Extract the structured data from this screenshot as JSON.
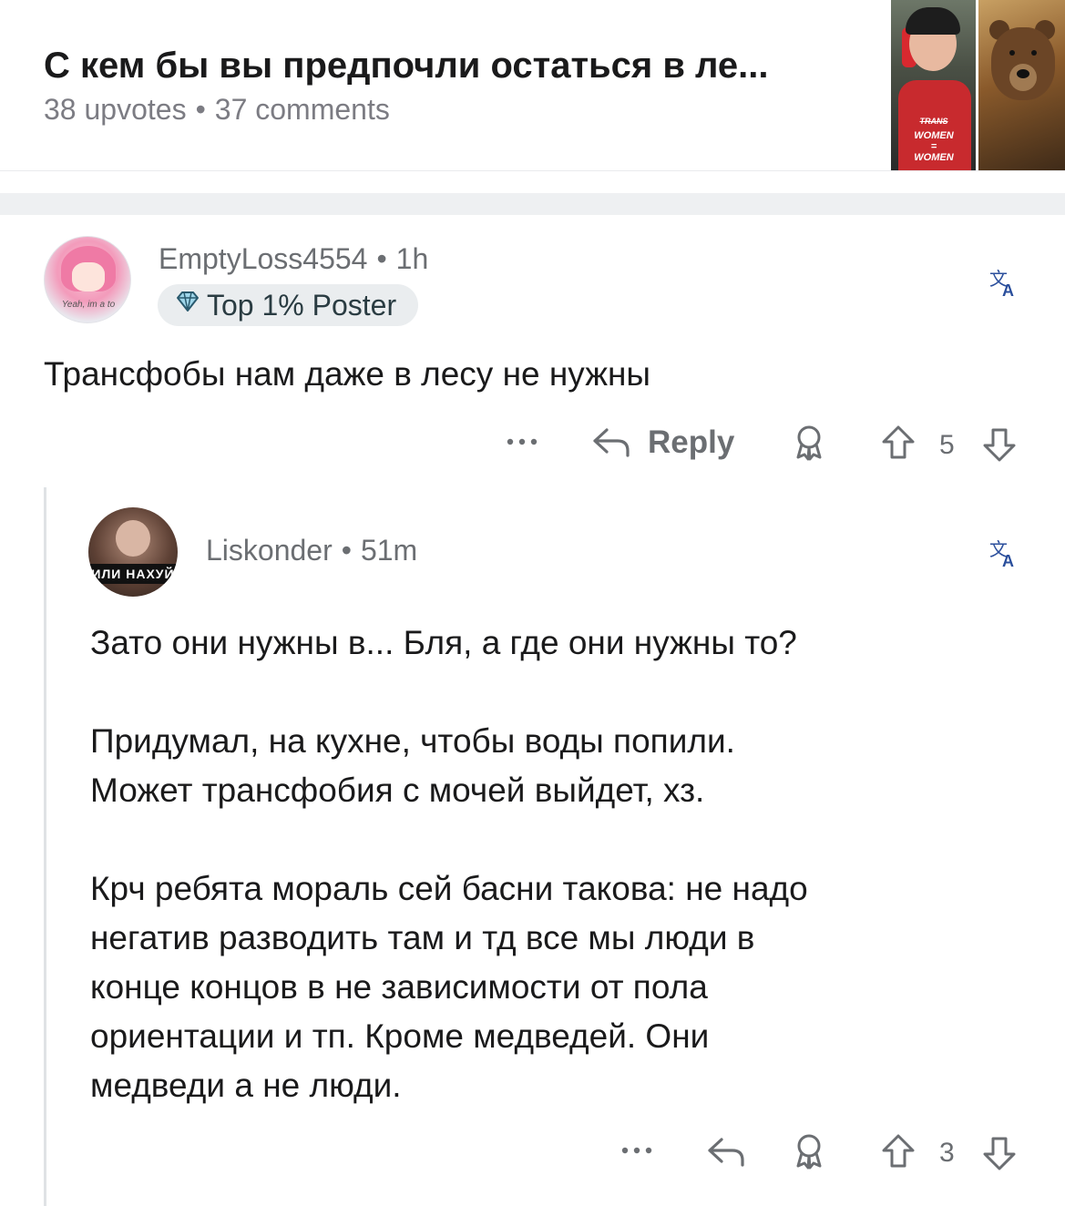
{
  "post": {
    "title": "С кем бы вы предпочли остаться в ле...",
    "upvotes": "38 upvotes",
    "separator": "•",
    "comments": "37 comments",
    "thumbnail": {
      "shirt_text_top": "TRANS",
      "shirt_text_mid": "WOMEN",
      "shirt_text_eq": "=",
      "shirt_text_bottom": "WOMEN"
    }
  },
  "comments": [
    {
      "username": "EmptyLoss4554",
      "dot": "•",
      "time": "1h",
      "avatar_caption": "Yeah, im a to",
      "flair": "Top 1% Poster",
      "text": [
        "Трансфобы нам даже в лесу не нужны"
      ],
      "actions": {
        "more": "•••",
        "reply": "Reply",
        "score": "5"
      },
      "icons": [
        "translate-icon",
        "more-icon",
        "reply-icon",
        "award-icon",
        "upvote-icon",
        "downvote-icon"
      ]
    },
    {
      "username": "Liskonder",
      "dot": "•",
      "time": "51m",
      "avatar_caption": "ИЛИ НАХУЙ",
      "text_paragraphs": [
        [
          "Зато они нужны в... Бля, а где они нужны то?"
        ],
        [
          "Придумал, на кухне, чтобы воды попили.",
          "Может трансфобия с мочей выйдет, хз."
        ],
        [
          "Крч ребята мораль сей басни такова: не надо",
          "негатив разводить там и тд все мы люди в",
          "конце концов в не зависимости от пола",
          "ориентации и тп. Кроме медведей. Они",
          "медведи а не люди."
        ]
      ],
      "actions": {
        "more": "•••",
        "score": "3"
      },
      "icons": [
        "translate-icon",
        "more-icon",
        "reply-icon",
        "award-icon",
        "upvote-icon",
        "downvote-icon"
      ]
    }
  ]
}
